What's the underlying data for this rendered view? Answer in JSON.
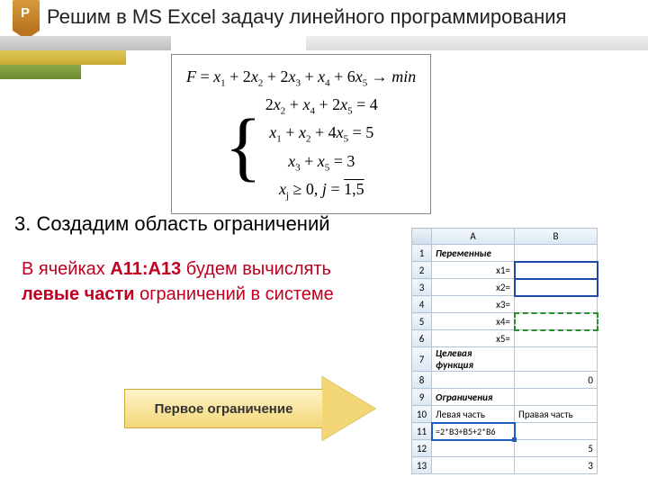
{
  "badge_letter": "P",
  "title": "Решим в MS Excel задачу линейного программирования",
  "formula": {
    "objective": "F = x₁ + 2x₂ + 2x₃ + x₄ + 6x₅ → min",
    "sys1": "2x₂ + x₄ + 2x₅ = 4",
    "sys2": "x₁ + x₂ + 4x₅ = 5",
    "sys3": "x₃ + x₅ = 3",
    "nonneg": "xⱼ ≥ 0,  j = 1,5"
  },
  "step_heading": "3. Создадим область ограничений",
  "paragraph": {
    "pre": "В ячейках ",
    "cells": "А11:А13",
    "mid": " будем вычислять ",
    "bold2": "левые части",
    "post": " ограничений в системе"
  },
  "arrow_label": "Первое ограничение",
  "excel": {
    "colA": "A",
    "colB": "B",
    "rows": {
      "1": {
        "A": "Переменные",
        "B": ""
      },
      "2": {
        "A": "x1=",
        "B": ""
      },
      "3": {
        "A": "x2=",
        "B": ""
      },
      "4": {
        "A": "x3=",
        "B": ""
      },
      "5": {
        "A": "x4=",
        "B": ""
      },
      "6": {
        "A": "x5=",
        "B": ""
      },
      "7": {
        "A": "Целевая функция",
        "B": ""
      },
      "8": {
        "A": "",
        "B": "0"
      },
      "9": {
        "A": "Ограничения",
        "B": ""
      },
      "10": {
        "A": "Левая часть",
        "B": "Правая часть"
      },
      "11": {
        "A": "=2*B3+B5+2*B6",
        "B": ""
      },
      "12": {
        "A": "",
        "B": "5"
      },
      "13": {
        "A": "",
        "B": "3"
      }
    }
  }
}
